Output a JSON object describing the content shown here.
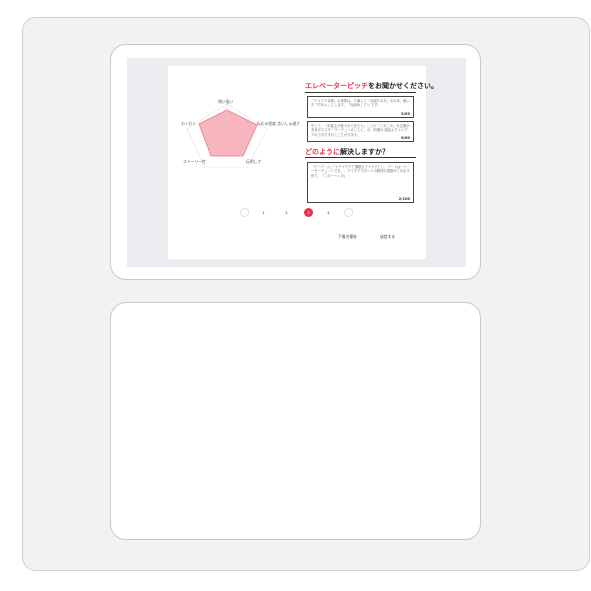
{
  "radar": {
    "labels": {
      "top": "問い悩い",
      "right": "伝わる程度 言いしゅ達さ",
      "bottom_right": "伝例しさ",
      "bottom_left": "ストーリー性",
      "left": "わくわく"
    },
    "colors": {
      "fill": "#f5a3ad",
      "stroke": "#e87a88"
    }
  },
  "question1": {
    "title_highlight": "エレベーターピッチ",
    "title_rest": "をお聞かせください。",
    "answers": [
      {
        "text": "「アイデア名称」の事業は、介護して「お困りの方」のため、使い方「打ゆ入」にします。「仕組み」アン です。",
        "count": "5/63"
      },
      {
        "text": "そして、「お客主が使うのであらう」ことの「これこの」な位置があるのでスモーワーデューのことに、の、利便の 製品よりメイデアのでお方きおしごとがすます。",
        "count": "6/60"
      }
    ]
  },
  "question2": {
    "title_highlight": "どのように",
    "title_rest": "解決しますか？",
    "answer": {
      "text": "「アーアーム」「ナアイデアで課題をアイデアとし、アートは一トーモーデュートでお、、アイデアラダントの解決の道筋がこのます形で、「このー〜」の」",
      "count": "2/100"
    }
  },
  "pagination": {
    "pages": [
      "1",
      "2",
      "3",
      "4"
    ],
    "active_index": 2
  },
  "footer": {
    "save_draft": "下書き保存",
    "submit": "送信する"
  }
}
